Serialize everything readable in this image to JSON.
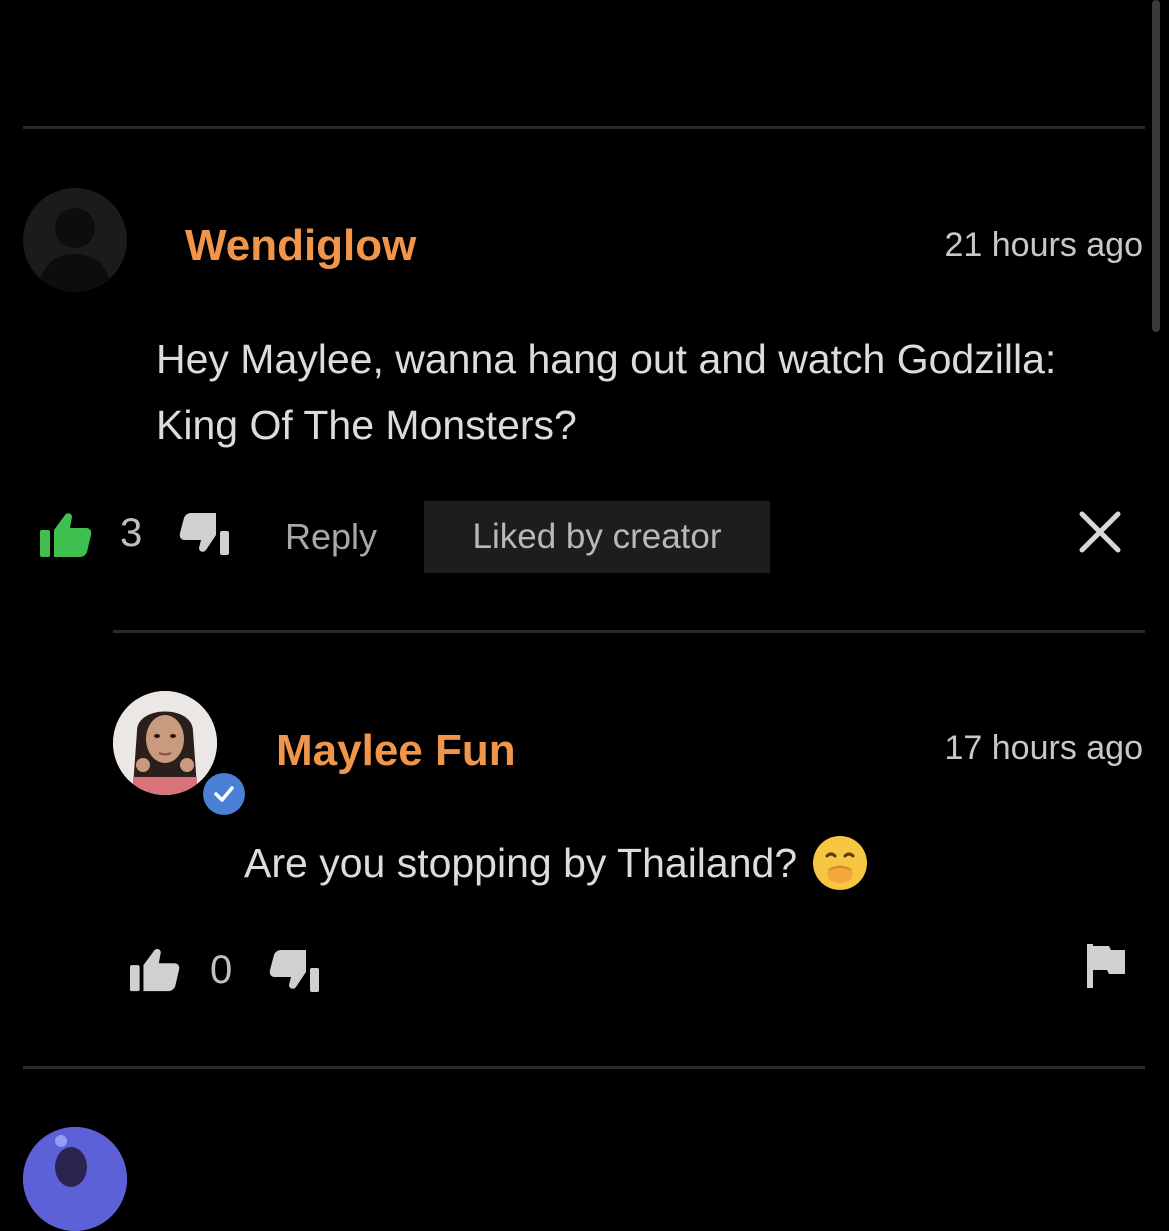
{
  "comments": [
    {
      "username": "Wendiglow",
      "timestamp": "21 hours ago",
      "text_line1": "Hey Maylee, wanna hang out and watch Godzilla:",
      "text_line2": "King Of The Monsters?",
      "likes": "3",
      "reply_label": "Reply",
      "badge": "Liked by creator"
    },
    {
      "username": "Maylee Fun",
      "timestamp": "17 hours ago",
      "text": "Are you stopping by Thailand?",
      "emoji": "🤭",
      "likes": "0",
      "verified": true
    }
  ],
  "colors": {
    "background": "#000000",
    "username": "#f0954a",
    "liked_thumb": "#3fbf4f",
    "verified_badge": "#4a7fd6"
  },
  "icons": [
    "thumbs-up-icon",
    "thumbs-down-icon",
    "close-icon",
    "flag-icon",
    "verified-check-icon"
  ]
}
